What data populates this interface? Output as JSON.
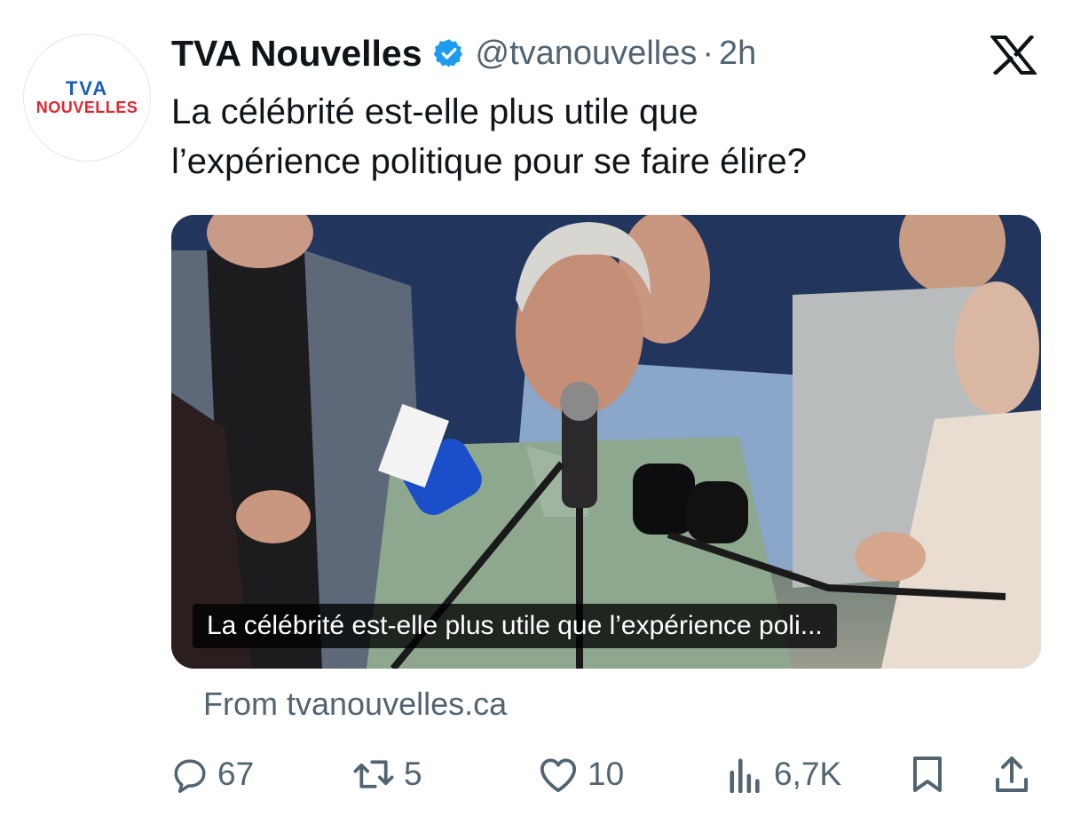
{
  "account": {
    "logo_top": "TVA",
    "logo_bottom": "NOUVELLES",
    "name": "TVA Nouvelles",
    "handle": "@tvanouvelles",
    "separator": "·",
    "time": "2h"
  },
  "tweet": {
    "text_line1": "La célébrité est-elle plus utile que",
    "text_line2": "l’expérience politique pour se faire élire?"
  },
  "media": {
    "caption": "La célébrité est-elle plus utile que l’expérience poli..."
  },
  "source": "From tvanouvelles.ca",
  "actions": {
    "replies": "67",
    "reposts": "5",
    "likes": "10",
    "views": "6,7K"
  },
  "colors": {
    "verified": "#1d9bf0",
    "secondary_text": "#536471",
    "brand_blue": "#1a5fb4",
    "brand_red": "#e3262e"
  }
}
